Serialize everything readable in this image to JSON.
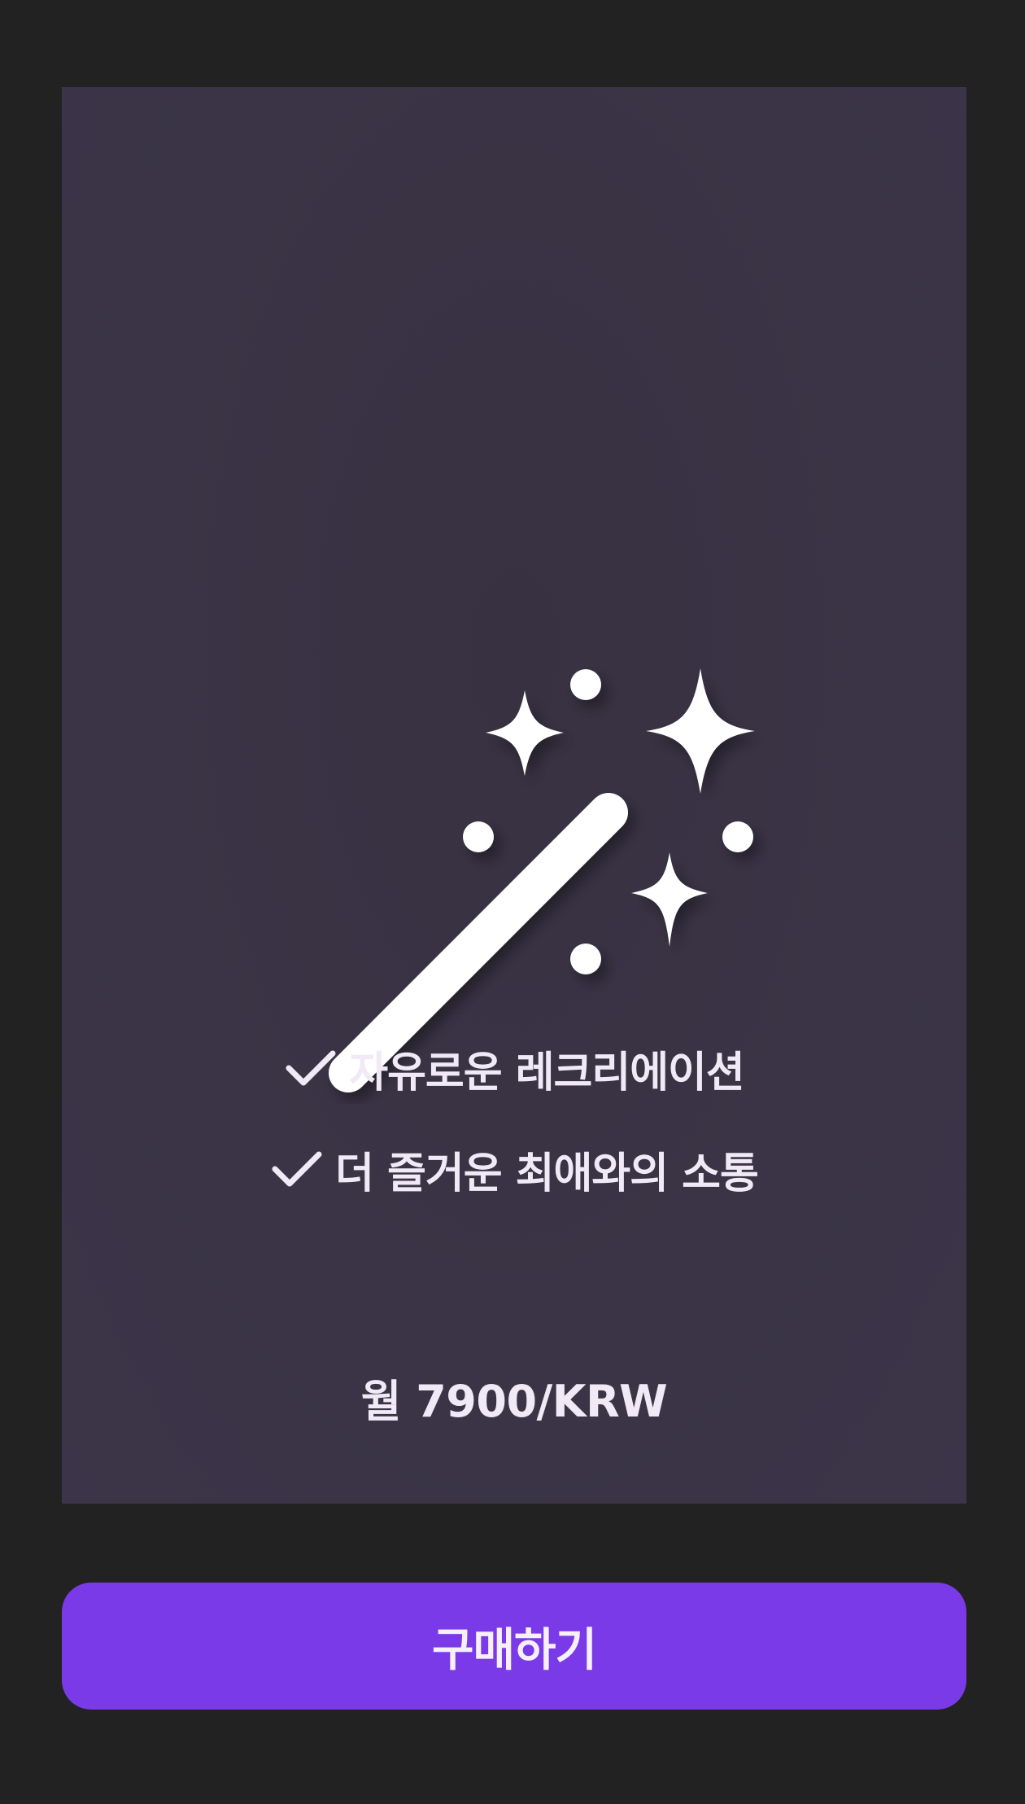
{
  "card": {
    "icon": "magic-wand-sparkles-icon",
    "features": [
      {
        "icon": "checkmark-icon",
        "label": "자유로운 레크리에이션"
      },
      {
        "icon": "checkmark-icon",
        "label": "더 즐거운 최애와의 소통"
      }
    ],
    "price": "월 7900/KRW"
  },
  "purchase": {
    "label": "구매하기"
  },
  "colors": {
    "background": "#222222",
    "card": "#3a3446",
    "text": "#f1eaf6",
    "accent": "#7a3ae8"
  }
}
